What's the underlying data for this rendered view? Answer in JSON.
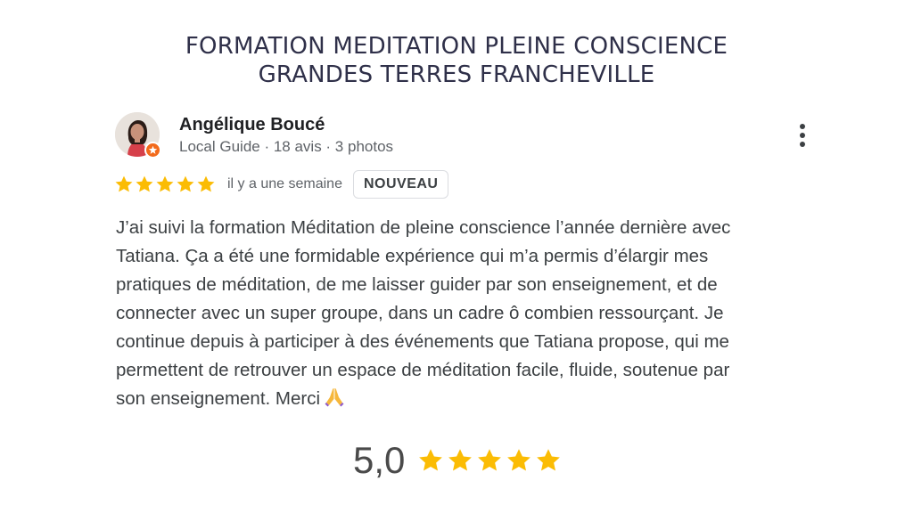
{
  "heading": {
    "line1": "FORMATION MEDITATION PLEINE CONSCIENCE",
    "line2": "GRANDES TERRES FRANCHEVILLE"
  },
  "review": {
    "reviewer_name": "Angélique Boucé",
    "reviewer_meta": "Local Guide · 18 avis · 3 photos",
    "stars": 5,
    "date": "il y a une semaine",
    "badge": "NOUVEAU",
    "body_lines": [
      "J’ai suivi la formation Méditation de pleine conscience l’année dernière avec",
      "Tatiana. Ça a été une formidable expérience qui m’a permis d’élargir mes",
      "pratiques de méditation, de me laisser guider par son enseignement, et de",
      "connecter avec un super groupe, dans un cadre ô combien ressourçant. Je",
      "continue depuis à participer à des événements que Tatiana propose, qui me",
      "permettent de retrouver un espace de méditation facile, fluide, soutenue par",
      "son enseignement. Merci"
    ],
    "emoji": "folded-hands-icon"
  },
  "summary": {
    "score": "5,0",
    "stars": 5
  },
  "colors": {
    "star": "#fbbc04",
    "heading": "#2f3049",
    "guide_badge": "#f26a1b",
    "text": "#3c4043"
  }
}
